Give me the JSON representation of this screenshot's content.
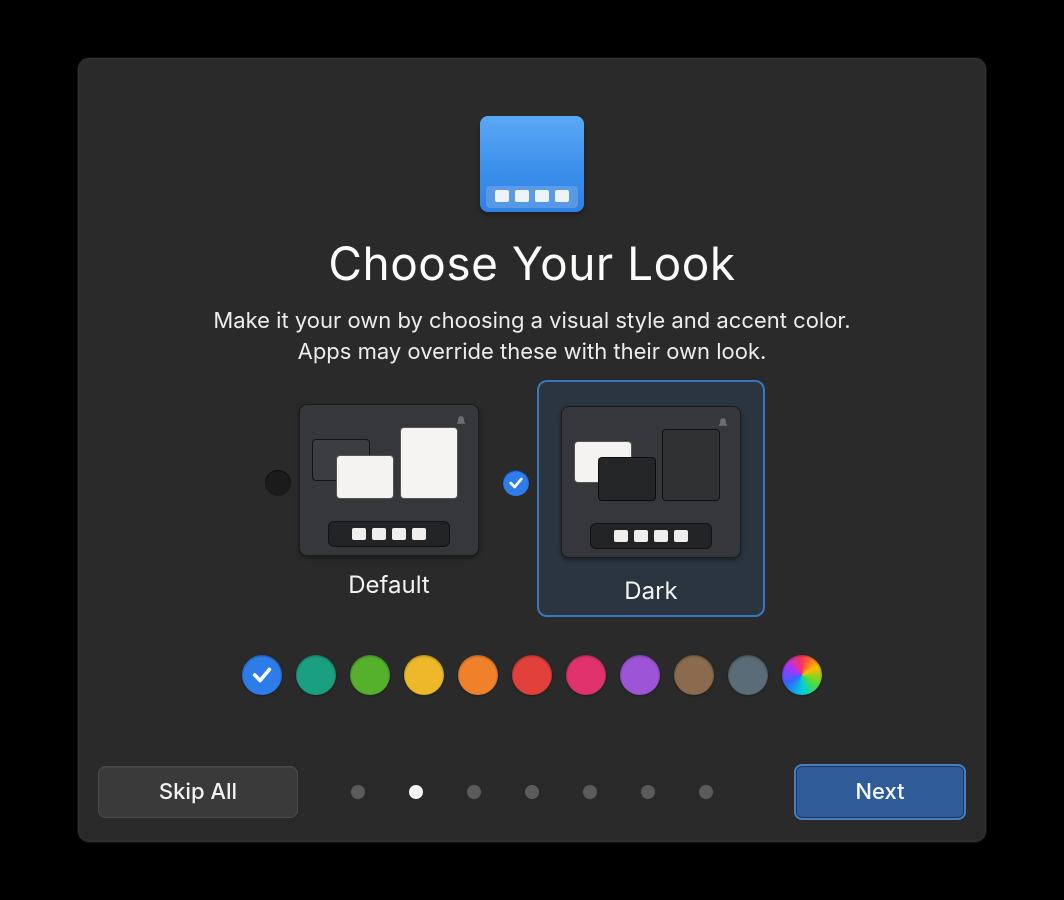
{
  "title": "Choose Your Look",
  "subtitle_line1": "Make it your own by choosing a visual style and accent color.",
  "subtitle_line2": "Apps may override these with their own look.",
  "themes": [
    {
      "id": "default",
      "label": "Default",
      "selected": false
    },
    {
      "id": "dark",
      "label": "Dark",
      "selected": true
    }
  ],
  "accents": [
    {
      "name": "blue",
      "color": "#2d7cea",
      "selected": true
    },
    {
      "name": "teal",
      "color": "#1aa081",
      "selected": false
    },
    {
      "name": "green",
      "color": "#55b02c",
      "selected": false
    },
    {
      "name": "yellow",
      "color": "#eeb82b",
      "selected": false
    },
    {
      "name": "orange",
      "color": "#f0812b",
      "selected": false
    },
    {
      "name": "red",
      "color": "#e2403b",
      "selected": false
    },
    {
      "name": "magenta",
      "color": "#e0336d",
      "selected": false
    },
    {
      "name": "purple",
      "color": "#9e54d6",
      "selected": false
    },
    {
      "name": "brown",
      "color": "#8b6a4d",
      "selected": false
    },
    {
      "name": "slate",
      "color": "#5a6c77",
      "selected": false
    },
    {
      "name": "rainbow",
      "color": "rainbow",
      "selected": false
    }
  ],
  "pager": {
    "total": 7,
    "active_index": 1
  },
  "buttons": {
    "skip": "Skip All",
    "next": "Next"
  }
}
